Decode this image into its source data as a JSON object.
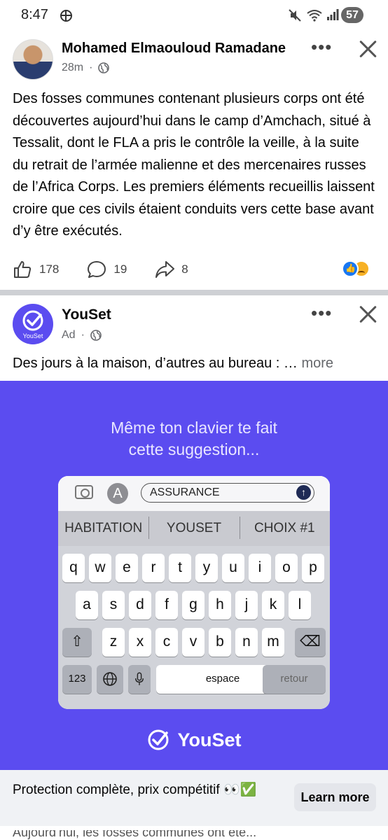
{
  "status_bar": {
    "time": "8:47",
    "battery": "57"
  },
  "post1": {
    "author": "Mohamed Elmaouloud Ramadane",
    "time": "28m",
    "text": "Des fosses communes contenant plusieurs corps ont été découvertes aujourd’hui dans le camp d’Amchach, situé à Tessalit, dont le FLA a pris le contrôle la veille, à la suite du retrait de l’armée malienne et des mercenaires russes de l’Africa Corps. Les premiers éléments recueillis laissent croire que ces civils étaient conduits vers cette base avant d’y être exécutés.",
    "likes": "178",
    "comments": "19",
    "shares": "8"
  },
  "ad": {
    "sponsor": "YouSet",
    "label": "Ad",
    "text": "Des jours à la maison, d’autres au bureau : …",
    "more": "more",
    "avatar_caption": "YouSet",
    "headline": "Même ton clavier te fait\ncette suggestion...",
    "keyboard": {
      "input": "ASSURANCE",
      "suggestions": [
        "HABITATION",
        "YOUSET",
        "CHOIX #1"
      ],
      "row1": [
        "q",
        "w",
        "e",
        "r",
        "t",
        "y",
        "u",
        "i",
        "o",
        "p"
      ],
      "row2": [
        "a",
        "s",
        "d",
        "f",
        "g",
        "h",
        "j",
        "k",
        "l"
      ],
      "row3": [
        "z",
        "x",
        "c",
        "v",
        "b",
        "n",
        "m"
      ],
      "numbers_key": "123",
      "space_key": "espace",
      "return_key": "retour"
    },
    "brand": "YouSet",
    "cta_text": "Protection complète, prix compétitif 👀✅",
    "cta_button": "Learn more",
    "next_peek": "Aujourd’hui, les fosses communes ont été..."
  },
  "colors": {
    "brand_purple": "#5b4cf0",
    "text": "#050505",
    "secondary": "#65676b",
    "like_blue": "#1877f2"
  },
  "icons": [
    "basketball-icon",
    "mute-icon",
    "wifi-icon",
    "signal-icon",
    "globe-icon",
    "more-dots-icon",
    "close-icon",
    "like-icon",
    "comment-icon",
    "share-icon",
    "camera-icon",
    "appstore-icon",
    "send-arrow-icon",
    "shift-icon",
    "backspace-icon",
    "globe-key-icon",
    "mic-icon",
    "youset-check-icon"
  ]
}
